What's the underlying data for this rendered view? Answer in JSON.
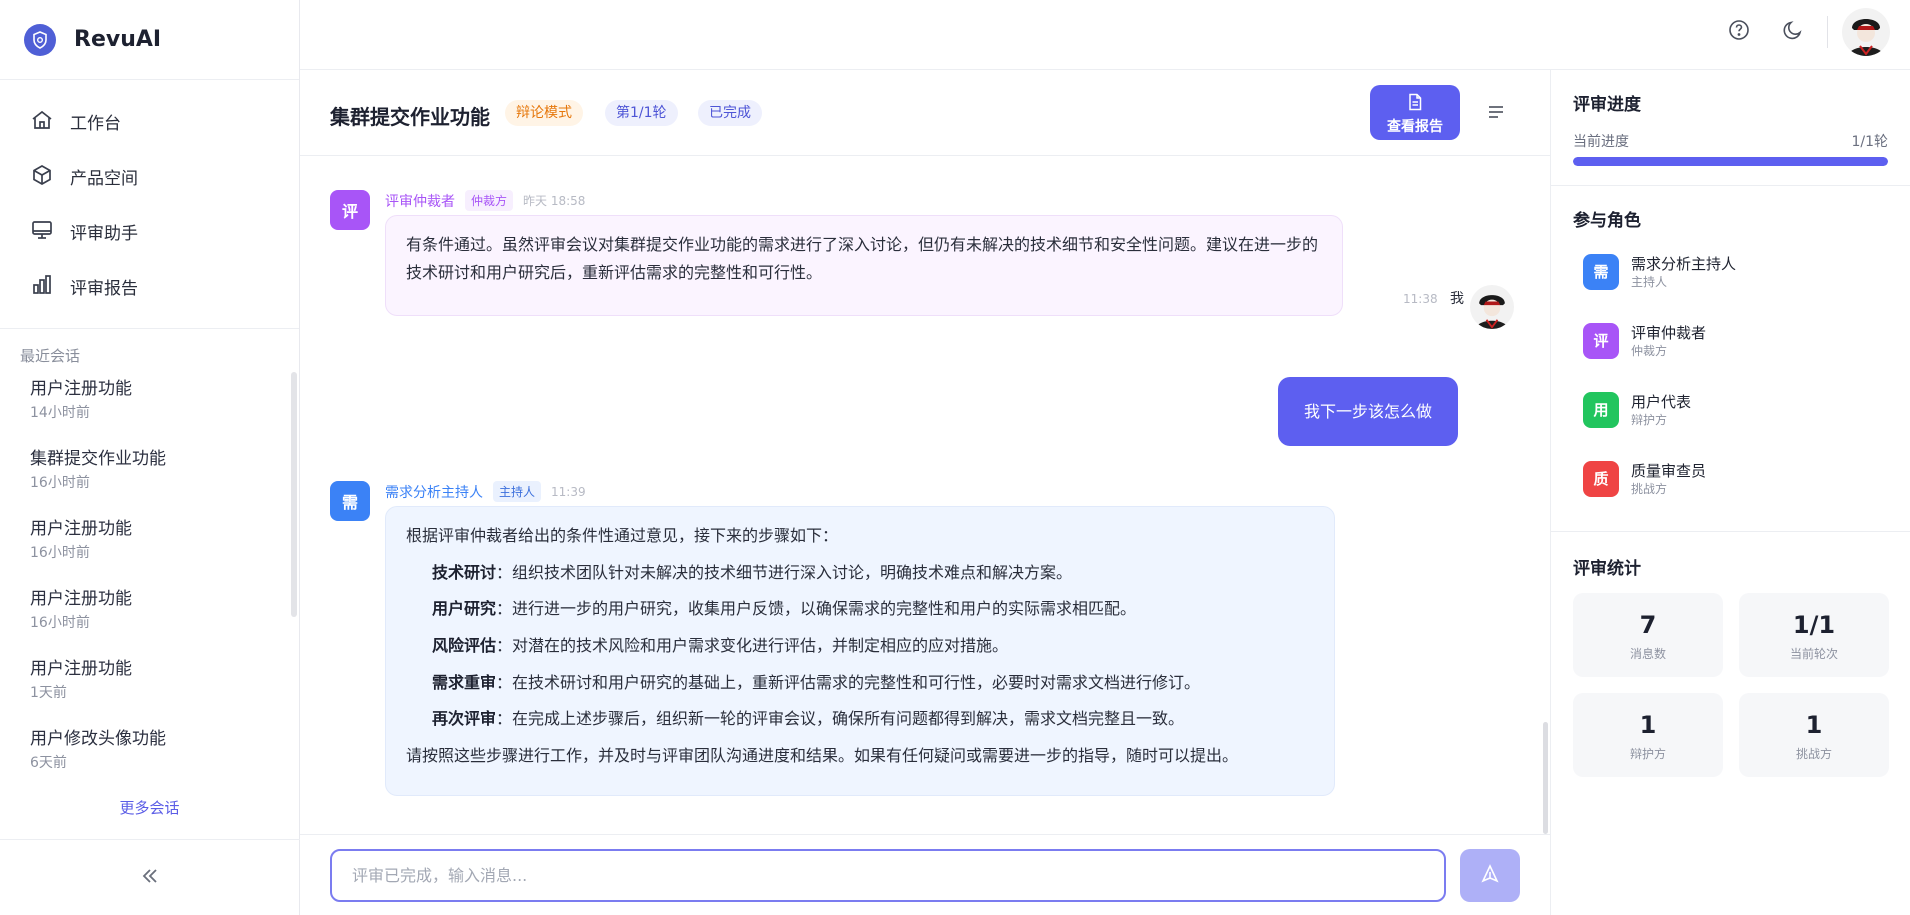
{
  "app": {
    "name": "RevuAI"
  },
  "nav": [
    {
      "label": "工作台",
      "icon": "home-icon"
    },
    {
      "label": "产品空间",
      "icon": "cube-icon"
    },
    {
      "label": "评审助手",
      "icon": "monitor-icon"
    },
    {
      "label": "评审报告",
      "icon": "bar-chart-icon"
    }
  ],
  "recent": {
    "title": "最近会话",
    "items": [
      {
        "name": "用户注册功能",
        "time": "14小时前"
      },
      {
        "name": "集群提交作业功能",
        "time": "16小时前"
      },
      {
        "name": "用户注册功能",
        "time": "16小时前"
      },
      {
        "name": "用户注册功能",
        "time": "16小时前"
      },
      {
        "name": "用户注册功能",
        "time": "1天前"
      },
      {
        "name": "用户修改头像功能",
        "time": "6天前"
      }
    ],
    "more": "更多会话"
  },
  "header": {
    "title": "集群提交作业功能",
    "mode": "辩论模式",
    "round": "第1/1轮",
    "status": "已完成",
    "report_button": "查看报告"
  },
  "messages": {
    "arbiter": {
      "avatar": "评",
      "name": "评审仲裁者",
      "tag": "仲裁方",
      "time": "昨天 18:58",
      "text": "有条件通过。虽然评审会议对集群提交作业功能的需求进行了深入讨论，但仍有未解决的技术细节和安全性问题。建议在进一步的技术研讨和用户研究后，重新评估需求的完整性和可行性。"
    },
    "user": {
      "time": "11:38",
      "name": "我",
      "text": "我下一步该怎么做"
    },
    "host": {
      "avatar": "需",
      "name": "需求分析主持人",
      "tag": "主持人",
      "time": "11:39",
      "intro": "根据评审仲裁者给出的条件性通过意见，接下来的步骤如下：",
      "steps": [
        {
          "title": "技术研讨",
          "text": "：组织技术团队针对未解决的技术细节进行深入讨论，明确技术难点和解决方案。"
        },
        {
          "title": "用户研究",
          "text": "：进行进一步的用户研究，收集用户反馈，以确保需求的完整性和用户的实际需求相匹配。"
        },
        {
          "title": "风险评估",
          "text": "：对潜在的技术风险和用户需求变化进行评估，并制定相应的应对措施。"
        },
        {
          "title": "需求重审",
          "text": "：在技术研讨和用户研究的基础上，重新评估需求的完整性和可行性，必要时对需求文档进行修订。"
        },
        {
          "title": "再次评审",
          "text": "：在完成上述步骤后，组织新一轮的评审会议，确保所有问题都得到解决，需求文档完整且一致。"
        }
      ],
      "outro": "请按照这些步骤进行工作，并及时与评审团队沟通进度和结果。如果有任何疑问或需要进一步的指导，随时可以提出。"
    }
  },
  "composer": {
    "placeholder": "评审已完成，输入消息..."
  },
  "progress": {
    "title": "评审进度",
    "label": "当前进度",
    "value": "1/1轮",
    "fraction": 1.0
  },
  "roles": {
    "title": "参与角色",
    "items": [
      {
        "avatar": "需",
        "name": "需求分析主持人",
        "sub": "主持人",
        "color": "#3b82f6"
      },
      {
        "avatar": "评",
        "name": "评审仲裁者",
        "sub": "仲裁方",
        "color": "#a855f7"
      },
      {
        "avatar": "用",
        "name": "用户代表",
        "sub": "辩护方",
        "color": "#22c55e"
      },
      {
        "avatar": "质",
        "name": "质量审查员",
        "sub": "挑战方",
        "color": "#ef4444"
      }
    ]
  },
  "stats": {
    "title": "评审统计",
    "items": [
      {
        "value": "7",
        "label": "消息数"
      },
      {
        "value": "1/1",
        "label": "当前轮次"
      },
      {
        "value": "1",
        "label": "辩护方"
      },
      {
        "value": "1",
        "label": "挑战方"
      }
    ]
  },
  "colors": {
    "accent": "#5d5ff0",
    "arbiter": "#a855f7",
    "host": "#3b82f6",
    "mode_badge": "#e6770b"
  }
}
